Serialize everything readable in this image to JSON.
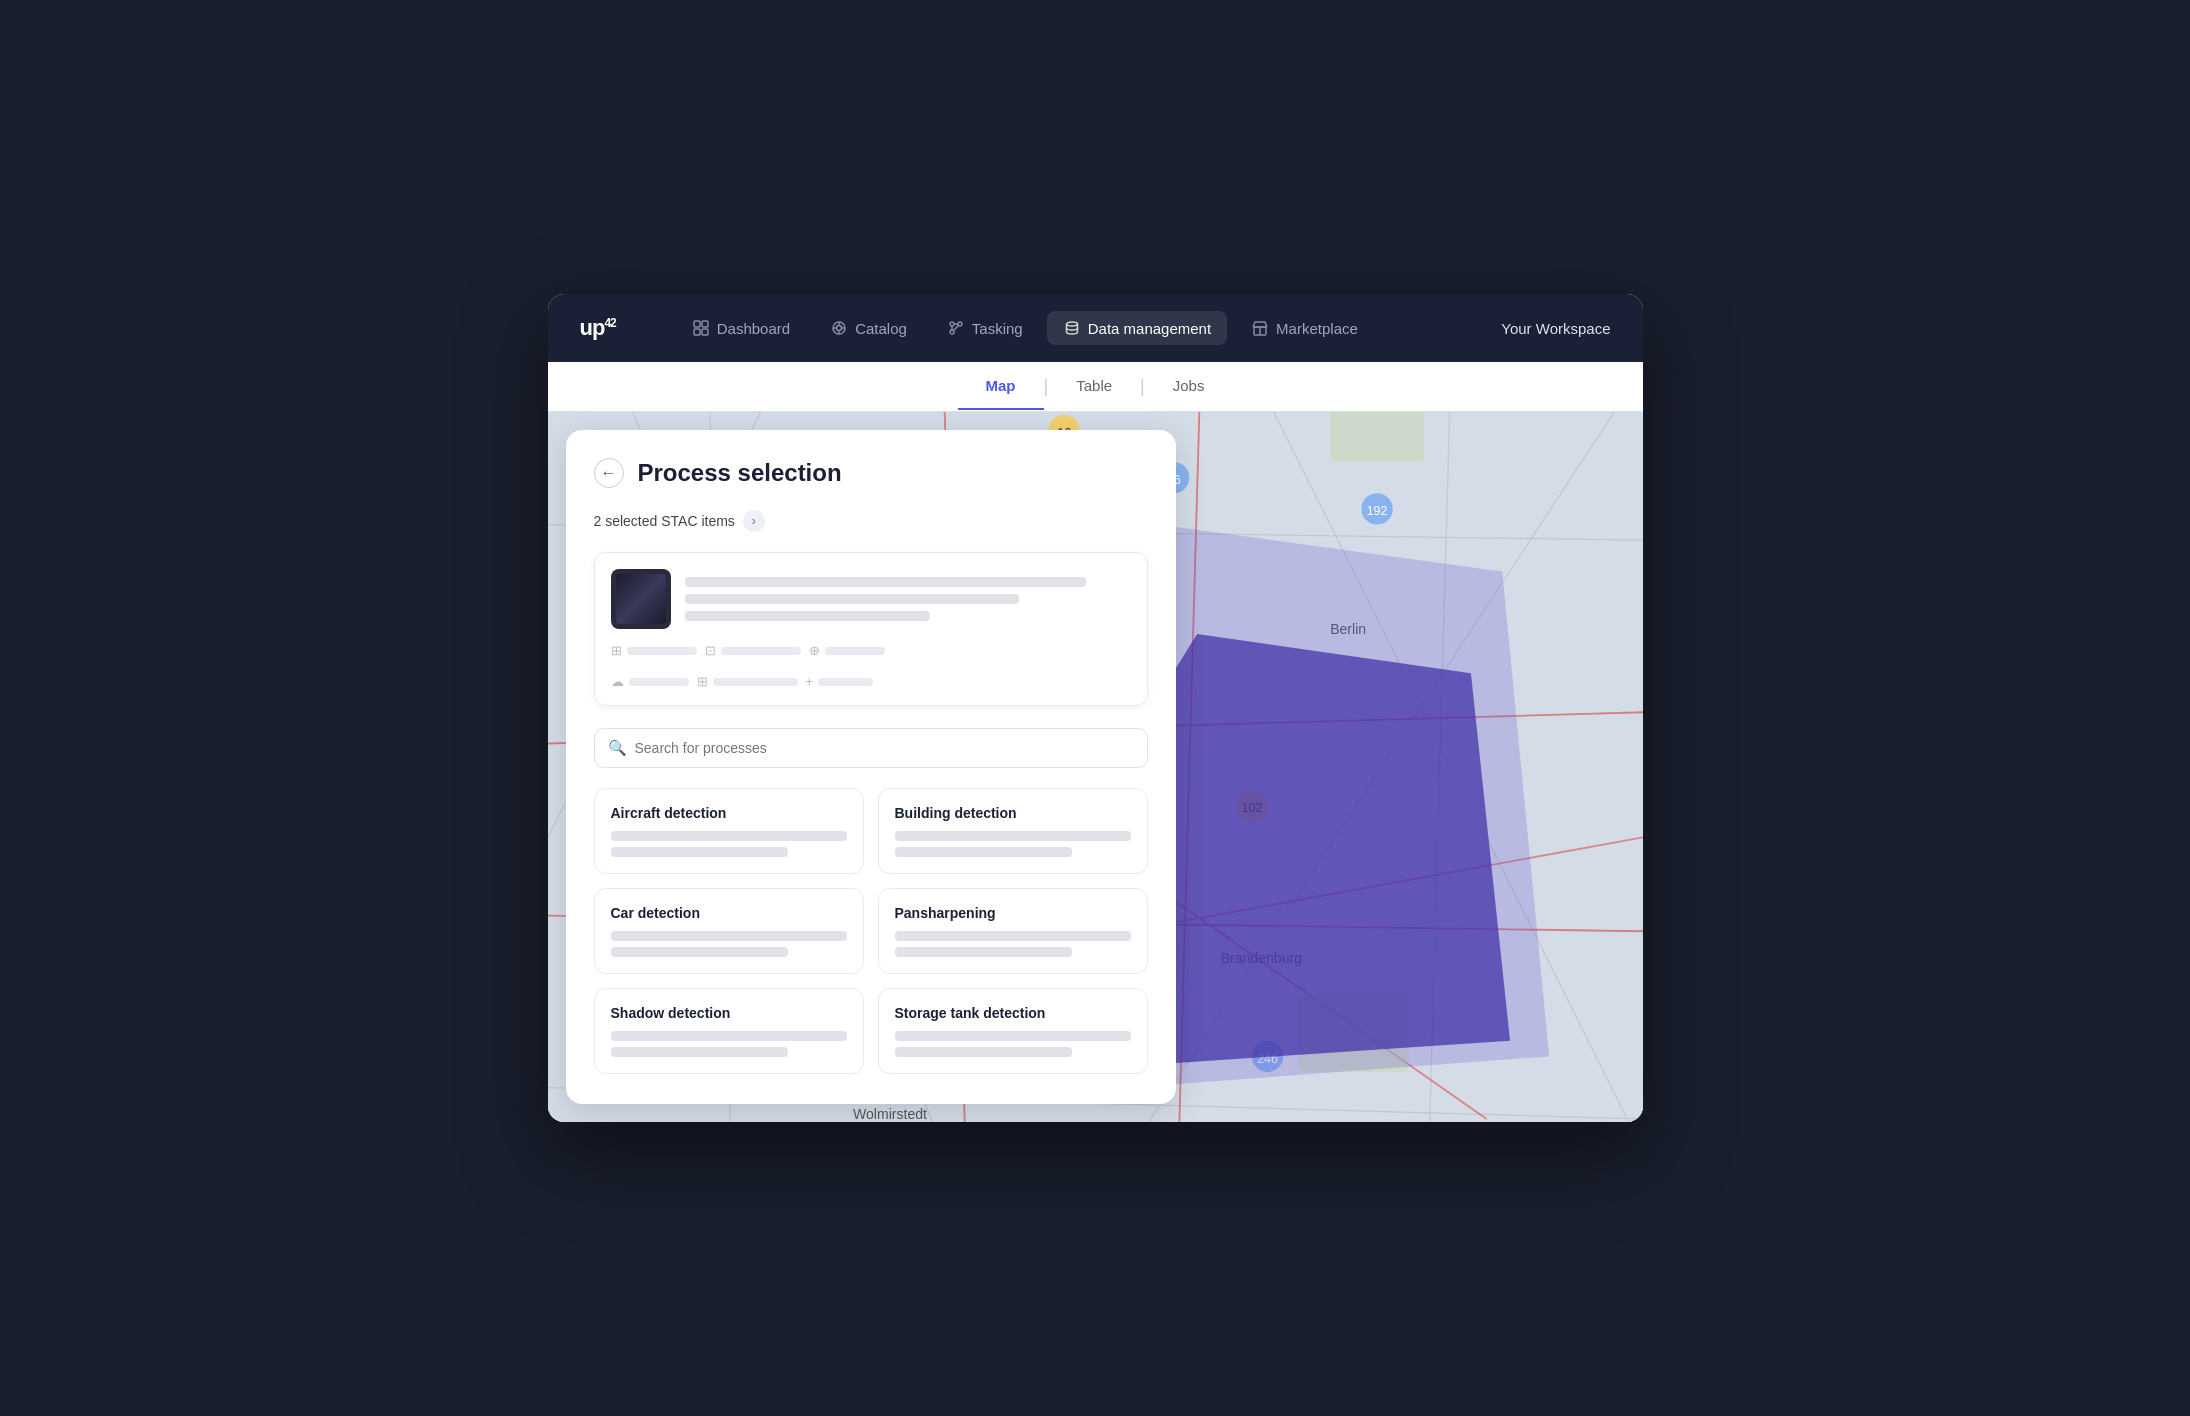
{
  "logo": {
    "text": "up",
    "superscript": "42"
  },
  "navbar": {
    "items": [
      {
        "id": "dashboard",
        "label": "Dashboard",
        "icon": "grid"
      },
      {
        "id": "catalog",
        "label": "Catalog",
        "icon": "search"
      },
      {
        "id": "tasking",
        "label": "Tasking",
        "icon": "share"
      },
      {
        "id": "data-management",
        "label": "Data management",
        "icon": "database",
        "active": true
      },
      {
        "id": "marketplace",
        "label": "Marketplace",
        "icon": "store"
      }
    ],
    "workspace_label": "Your Workspace"
  },
  "tabs": [
    {
      "id": "map",
      "label": "Map",
      "active": true
    },
    {
      "id": "table",
      "label": "Table"
    },
    {
      "id": "jobs",
      "label": "Jobs"
    }
  ],
  "panel": {
    "back_label": "←",
    "title": "Process selection",
    "stac_info": "2 selected STAC items",
    "search_placeholder": "Search for processes",
    "processes": [
      {
        "id": "aircraft",
        "title": "Aircraft detection"
      },
      {
        "id": "building",
        "title": "Building detection"
      },
      {
        "id": "car",
        "title": "Car detection"
      },
      {
        "id": "pansharpening",
        "title": "Pansharpening"
      },
      {
        "id": "shadow",
        "title": "Shadow detection"
      },
      {
        "id": "storage-tank",
        "title": "Storage tank detection"
      }
    ]
  }
}
